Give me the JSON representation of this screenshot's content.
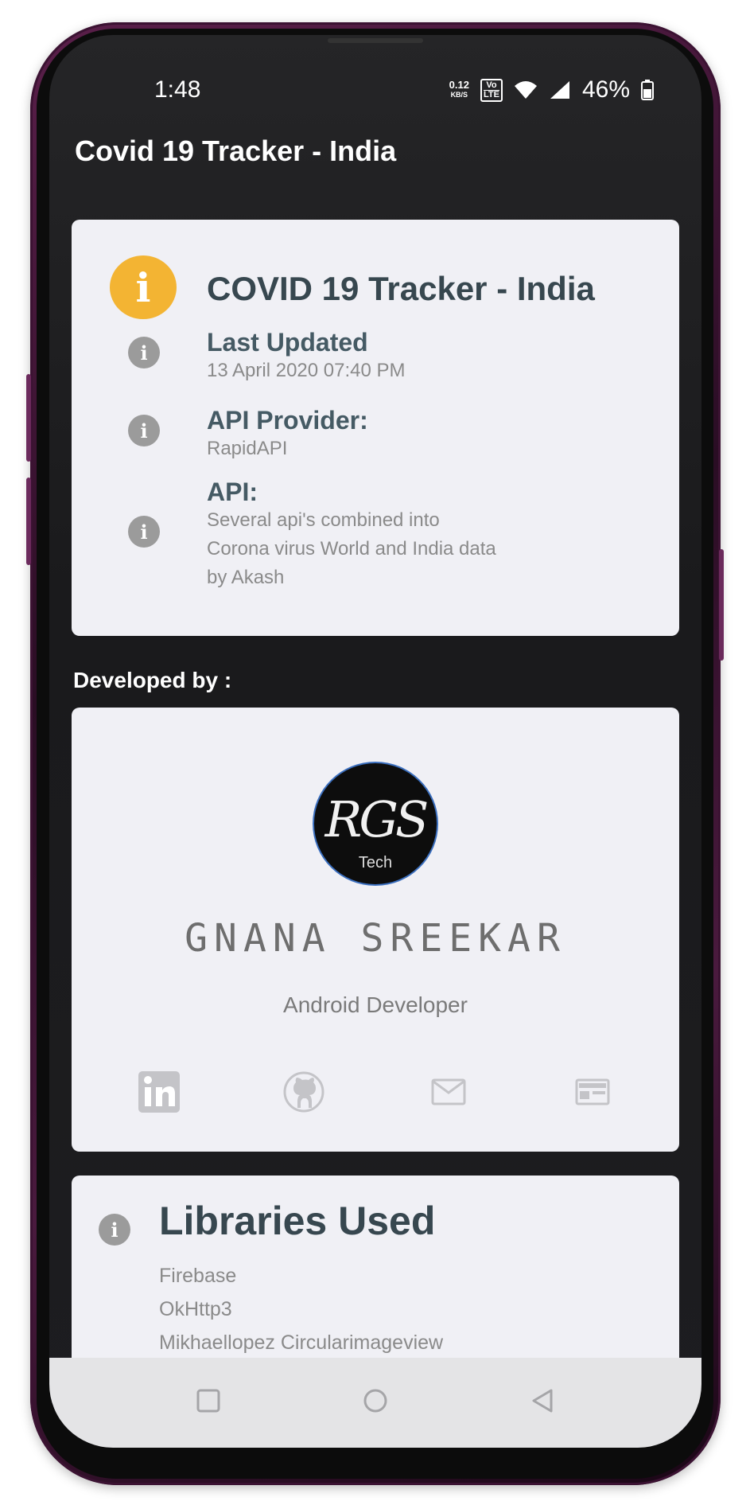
{
  "status_bar": {
    "time": "1:48",
    "network_speed_value": "0.12",
    "network_speed_unit": "KB/S",
    "volte_top": "Vo",
    "volte_bottom": "LTE",
    "battery": "46%"
  },
  "app_bar": {
    "title": "Covid 19 Tracker - India"
  },
  "info_card": {
    "title": "COVID 19 Tracker - India",
    "last_updated_label": "Last Updated",
    "last_updated_value": "13 April 2020 07:40 PM",
    "api_provider_label": "API Provider:",
    "api_provider_value": "RapidAPI",
    "api_label": "API:",
    "api_lines": [
      "Several api's combined into",
      "Corona virus World and India data",
      "by Akash"
    ]
  },
  "developer_section": {
    "label": "Developed by :",
    "logo_text": "RGS",
    "logo_subtext": "Tech",
    "name": "GNANA SREEKAR",
    "role": "Android Developer",
    "social_icons": [
      "linkedin-icon",
      "github-icon",
      "mail-icon",
      "web-icon"
    ]
  },
  "libraries_card": {
    "title": "Libraries Used",
    "items": [
      "Firebase",
      "OkHttp3",
      "Mikhaellopez Circularimageview"
    ]
  },
  "colors": {
    "accent_yellow": "#f3b433",
    "title_dark": "#37474f",
    "card_bg": "#f0f0f5",
    "app_bg": "#1e1e20"
  }
}
